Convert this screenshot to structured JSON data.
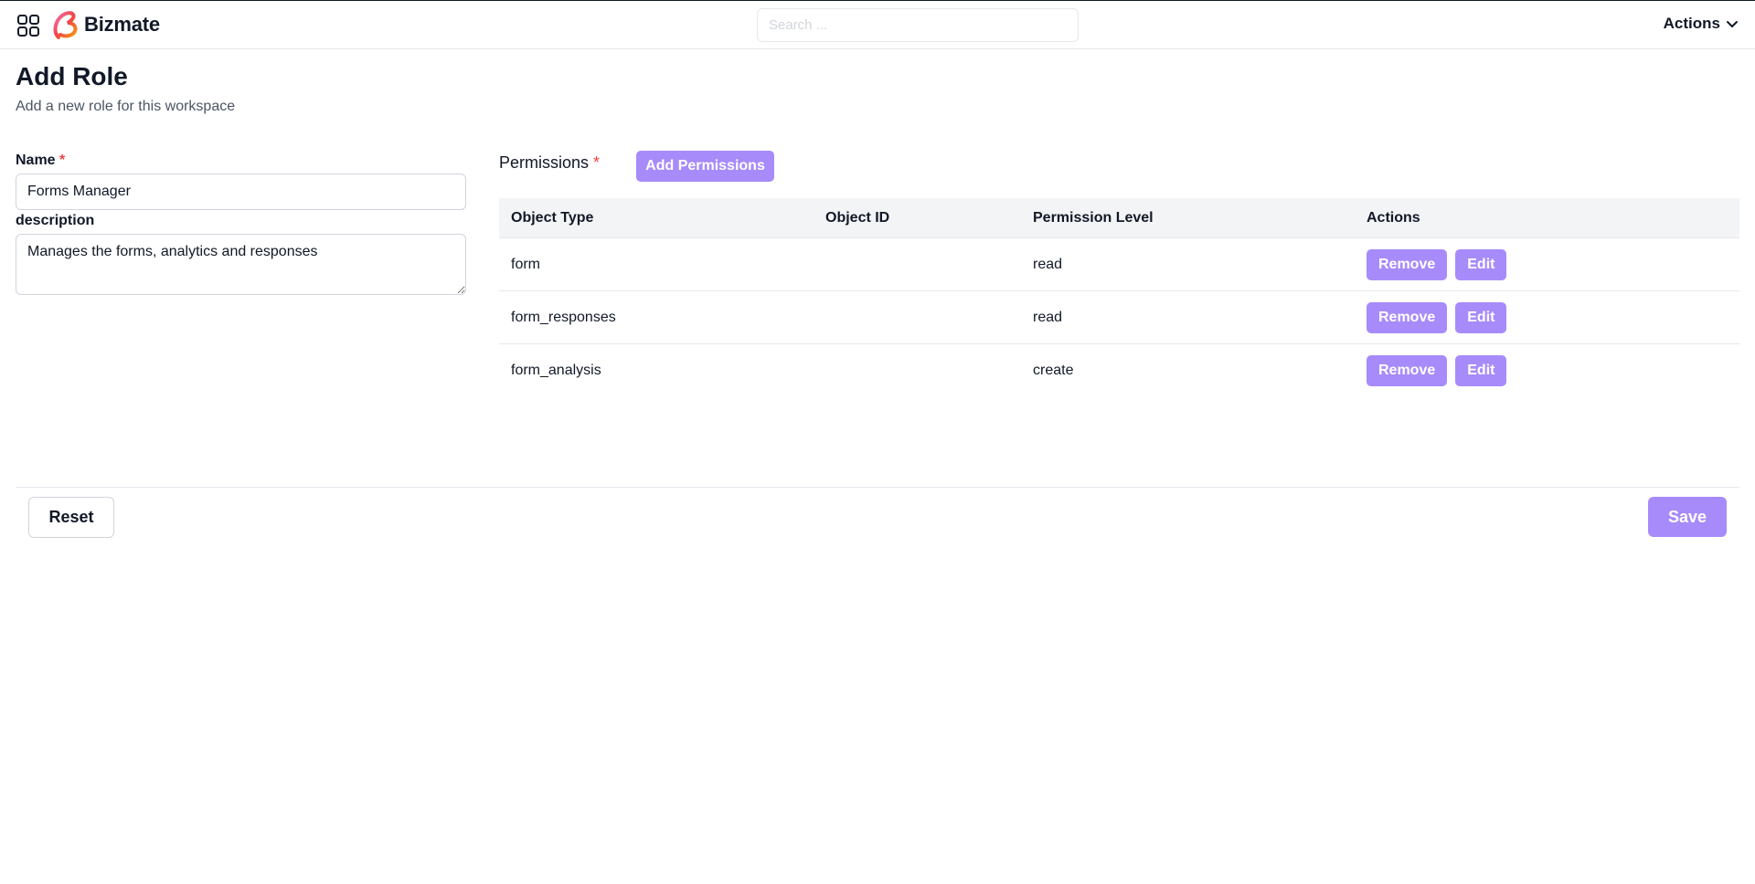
{
  "app": {
    "brand": "Bizmate"
  },
  "nav": {
    "search_placeholder": "Search ...",
    "actions_label": "Actions"
  },
  "header": {
    "title": "Add Role",
    "subtitle": "Add a new role for this workspace"
  },
  "form": {
    "name_label": "Name",
    "name_required": "*",
    "name_value": "Forms Manager",
    "description_label": "description",
    "description_value": "Manages the forms, analytics and responses"
  },
  "permissions": {
    "label": "Permissions",
    "required": "*",
    "add_button": "Add Permissions",
    "columns": [
      "Object Type",
      "Object ID",
      "Permission Level",
      "Actions"
    ],
    "rows": [
      {
        "object_type": "form",
        "object_id": "",
        "level": "read",
        "remove": "Remove",
        "edit": "Edit"
      },
      {
        "object_type": "form_responses",
        "object_id": "",
        "level": "read",
        "remove": "Remove",
        "edit": "Edit"
      },
      {
        "object_type": "form_analysis",
        "object_id": "",
        "level": "create",
        "remove": "Remove",
        "edit": "Edit"
      }
    ]
  },
  "footer": {
    "reset": "Reset",
    "save": "Save"
  },
  "colors": {
    "accent": "#a78bfa",
    "required": "#ef4444",
    "border": "#e5e7eb",
    "table_header_bg": "#f3f4f6"
  }
}
